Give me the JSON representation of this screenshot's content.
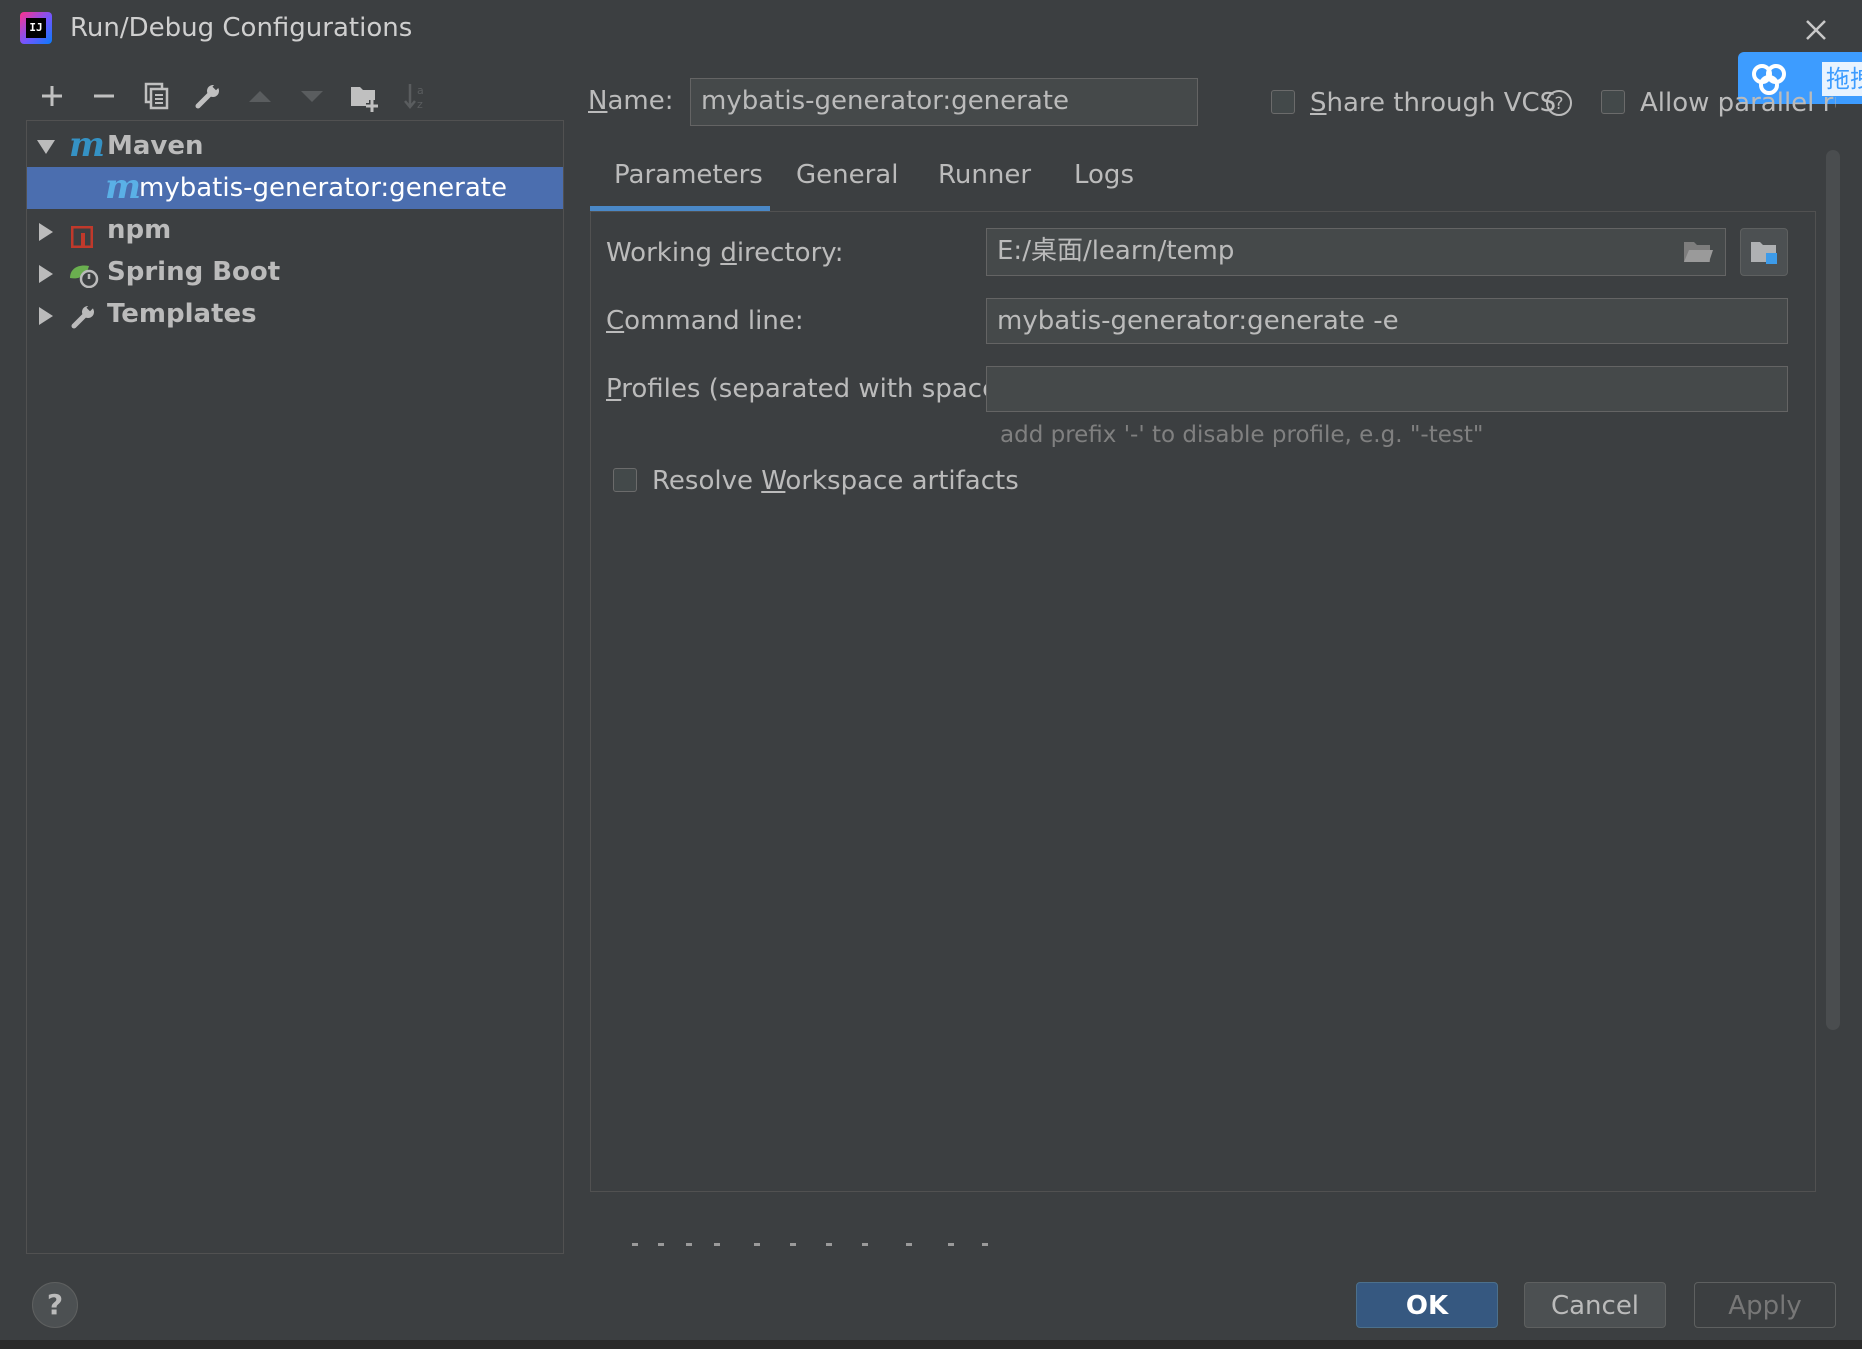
{
  "window": {
    "title": "Run/Debug Configurations"
  },
  "toolbar": {
    "icons": [
      "add-icon",
      "remove-icon",
      "copy-icon",
      "wrench-icon",
      "move-up-icon",
      "move-down-icon",
      "new-folder-icon",
      "sort-icon"
    ]
  },
  "tree": {
    "items": [
      {
        "label": "Maven",
        "icon": "maven-icon",
        "expanded": true
      },
      {
        "label": "mybatis-generator:generate",
        "icon": "maven-icon",
        "selected": true
      },
      {
        "label": "npm",
        "icon": "npm-icon",
        "expanded": false
      },
      {
        "label": "Spring Boot",
        "icon": "spring-boot-icon",
        "expanded": false
      },
      {
        "label": "Templates",
        "icon": "wrench-icon",
        "expanded": false
      }
    ]
  },
  "header": {
    "name_label_first": "N",
    "name_label_rest": "ame:",
    "name_value": "mybatis-generator:generate",
    "share_vcs_first": "S",
    "share_vcs_rest": "hare through VCS",
    "allow_parallel": "Allow parallel run"
  },
  "tabs": [
    {
      "label": "Parameters",
      "active": true
    },
    {
      "label": "General",
      "active": false
    },
    {
      "label": "Runner",
      "active": false
    },
    {
      "label": "Logs",
      "active": false
    }
  ],
  "parameters": {
    "working_dir_a": "Working ",
    "working_dir_u": "d",
    "working_dir_b": "irectory:",
    "working_dir_value": "E:/桌面/learn/temp",
    "command_u": "C",
    "command_rest": "ommand line:",
    "command_value": "mybatis-generator:generate -e",
    "profiles_u": "P",
    "profiles_rest": "rofiles (separated with space):",
    "profiles_value": "",
    "profiles_hint": "add prefix '-' to disable profile, e.g. \"-test\"",
    "resolve_a": "Resolve ",
    "resolve_u": "W",
    "resolve_b": "orkspace artifacts"
  },
  "buttons": {
    "ok": "OK",
    "cancel": "Cancel",
    "apply": "Apply",
    "help": "?"
  },
  "overlay": {
    "baidu_text": "拖拽"
  },
  "colors": {
    "accent": "#4b6eaf",
    "tab_underline": "#4a88c7",
    "ok_button": "#365880",
    "background": "#3c3f41"
  }
}
